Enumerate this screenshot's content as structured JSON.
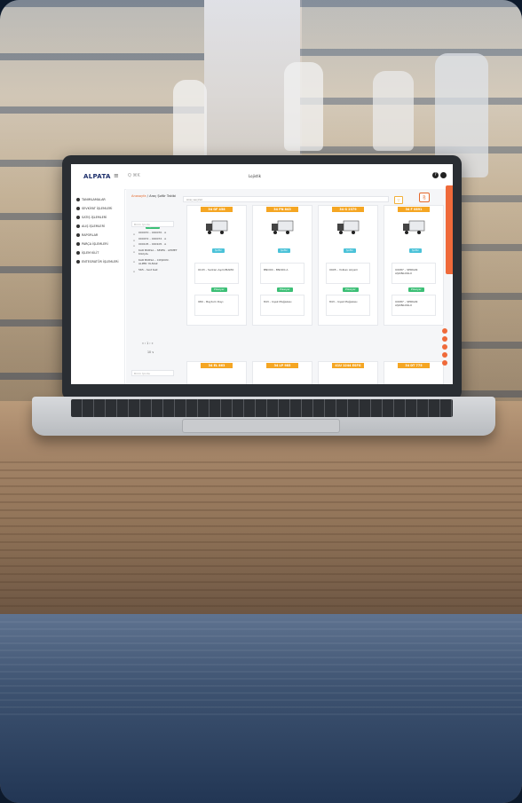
{
  "app": {
    "logo": "ALPATA",
    "menu_icon": "≡",
    "search_hint": "Q ⌘K",
    "center_title": "Lojistik",
    "help_icon": "?"
  },
  "sidebar": {
    "items": [
      {
        "label": "TANIMLAMALAR"
      },
      {
        "label": "SEVKİYAT İŞLEMLERİ"
      },
      {
        "label": "SATIŞ İŞLEMLERİ"
      },
      {
        "label": "ALIŞ İŞLEMLERİ"
      },
      {
        "label": "RAPORLAR"
      },
      {
        "label": "PARÇA İŞLEMLERİ"
      },
      {
        "label": "İŞLEM KİLİT"
      },
      {
        "label": "ENTEGRATÖR İŞLEMLERİ"
      }
    ]
  },
  "main": {
    "breadcrumb_home": "Anasayfa",
    "breadcrumb_sep": " / ",
    "breadcrumb_current": "Araç Şoför Takibi",
    "doc_icon": "⎘",
    "left_panel": {
      "badge": "Şoför",
      "search_placeholder": "Birim İçinde",
      "items": [
        {
          "label": "000070 – 000070 · A"
        },
        {
          "label": "000072 – 000072 · A"
        },
        {
          "label": "000105 – 000105 · A"
        },
        {
          "label": "KAR BURSA – SERFA · AHMET KILIÇAL"
        },
        {
          "label": "KAR BURSA – COŞKUN · ALPER YILMAZ"
        },
        {
          "label": "565 – test test"
        }
      ],
      "pager": "«  ‹  1  ›  »",
      "page_current": "1",
      "page_size": "10 ∨",
      "bottom_badge": "Plasiyer",
      "bottom_placeholder": "Birim İçinde"
    },
    "filter_placeholder": "Araç seçiniz",
    "filter_icon": "▽",
    "cards": [
      {
        "plate": "34 GF 458",
        "tag": "Şoför",
        "driver": "0103 – Serkan Aşım/MAMO",
        "tag2": "Plasiyer",
        "plasiyer": "980 – Baytum Dayı"
      },
      {
        "plate": "34 PN 843",
        "tag": "Şoför",
        "driver": "BNO00 – BNO00.A",
        "tag2": "Plasiyer",
        "plasiyer": "843 – Uşak Mağazası"
      },
      {
        "plate": "34 G 2379",
        "tag": "Şoför",
        "driver": "0905 – Volkan Akçam",
        "tag2": "Plasiyer",
        "plasiyer": "843 – Uşak Mağazası"
      },
      {
        "plate": "34 F 0891",
        "tag": "Şoför",
        "driver": "U0087 – SERKAN AŞKINLOĞLU",
        "tag2": "Plasiyer",
        "plasiyer": "U0087 – SERKAN AŞKINLOĞLU"
      }
    ],
    "bottom_cards": [
      {
        "plate": "34 EL 863"
      },
      {
        "plate": "34 LP 985"
      },
      {
        "plate": "41U 1244 ESFG"
      },
      {
        "plate": "34 DT 775"
      }
    ]
  },
  "colors": {
    "accent": "#e4682b",
    "plate": "#f5a623",
    "green": "#3cbf76",
    "cyan": "#4bc2d8"
  }
}
